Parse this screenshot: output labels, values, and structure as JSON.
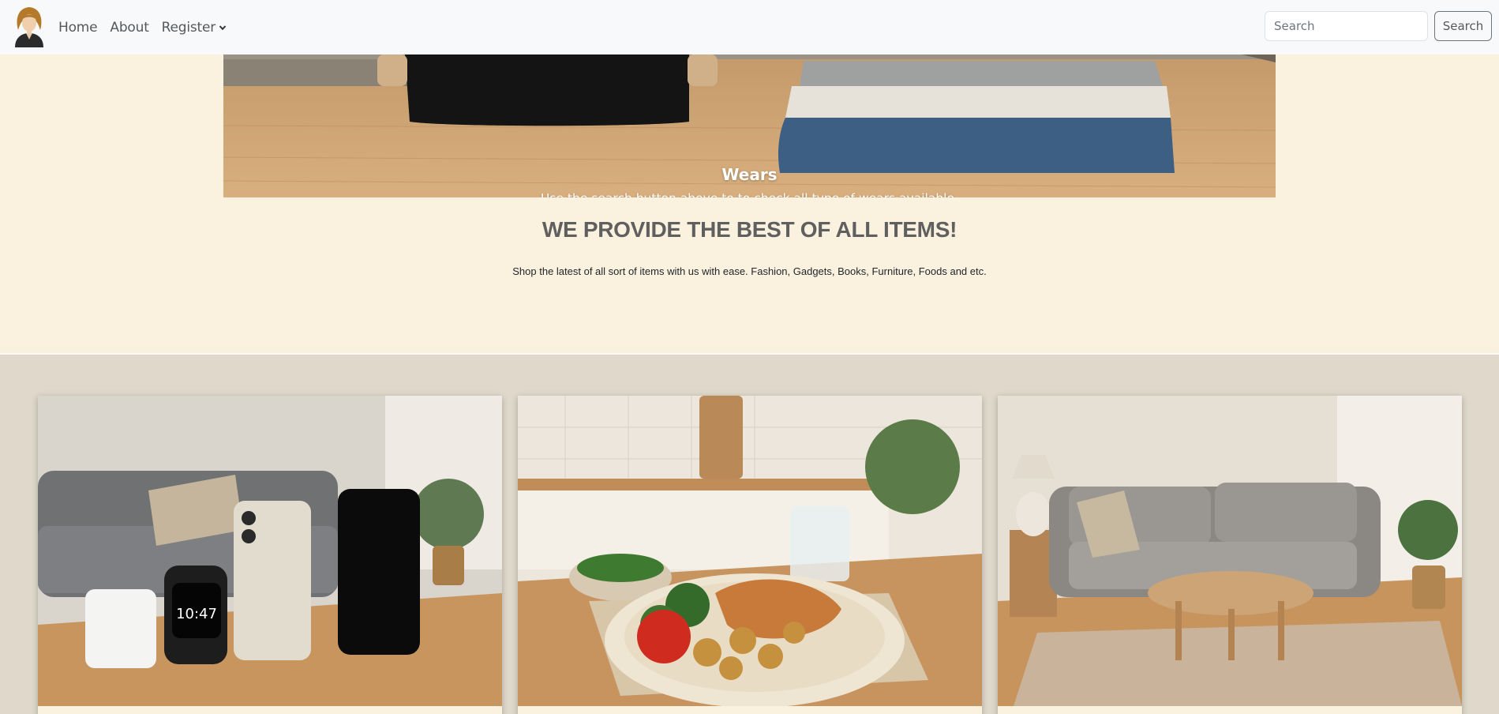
{
  "nav": {
    "links": [
      "Home",
      "About",
      "Register"
    ],
    "search_placeholder": "Search",
    "search_button": "Search"
  },
  "carousel": {
    "caption_title": "Wears",
    "caption_text": "Use the search button above to to check all type of wears available.",
    "slide_count": 4,
    "active_slide": 2
  },
  "hero": {
    "title": "WE PROVIDE THE BEST OF ALL ITEMS!",
    "subtitle": "Shop the latest of all sort of items with us with ease. Fashion, Gadgets, Books, Furniture, Foods and etc."
  },
  "cards": {
    "gadgets": {
      "watch_time": "10:47"
    }
  },
  "colors": {
    "page_bg": "#faf2df",
    "section_bg": "#e0d9cb",
    "nav_bg": "#f8f9fa",
    "title": "#5f5f5f"
  }
}
